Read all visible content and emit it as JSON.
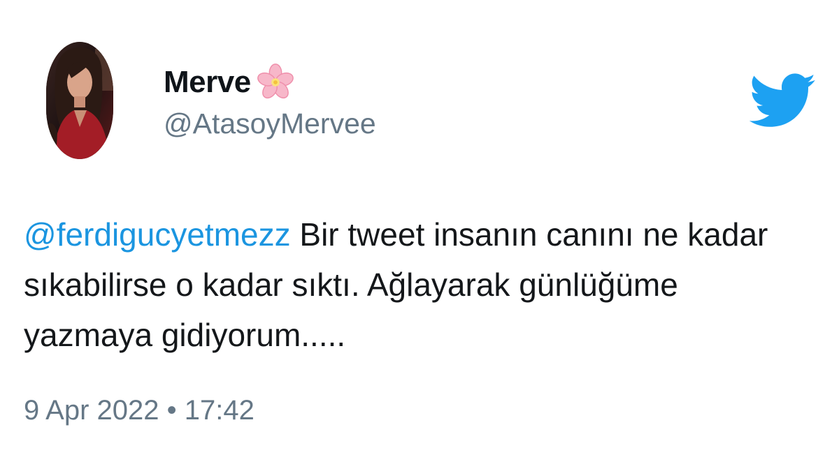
{
  "user": {
    "display_name": "Merve",
    "name_emoji": "cherry-blossom",
    "handle": "@AtasoyMervee"
  },
  "tweet": {
    "mention": "@ferdigucyetmezz",
    "text": " Bir tweet insanın canını ne kadar sıkabilirse o kadar sıktı. Ağlayarak günlüğüme yazmaya gidiyorum.....",
    "date": "9 Apr 2022",
    "separator": "•",
    "time": "17:42"
  },
  "icons": {
    "brand": "twitter-bird-icon"
  },
  "colors": {
    "mention": "#1b95e0",
    "twitter_blue": "#1da1f2",
    "secondary_text": "#657786",
    "primary_text": "#14171a"
  }
}
